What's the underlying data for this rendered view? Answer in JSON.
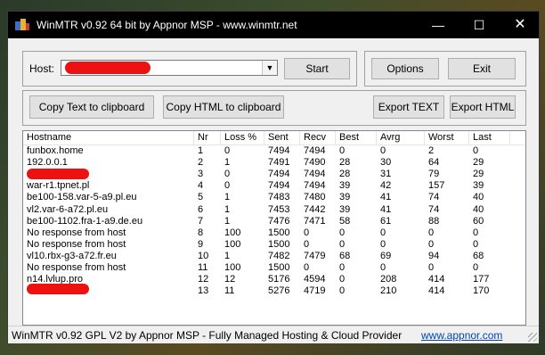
{
  "window": {
    "title": "WinMTR v0.92 64 bit by Appnor MSP - www.winmtr.net",
    "minimize_glyph": "—",
    "maximize_glyph": "☐",
    "close_glyph": "✕"
  },
  "host": {
    "label": "Host:",
    "value": ""
  },
  "buttons": {
    "start": "Start",
    "options": "Options",
    "exit": "Exit",
    "copy_text": "Copy Text to clipboard",
    "copy_html": "Copy HTML to clipboard",
    "export_text": "Export TEXT",
    "export_html": "Export HTML"
  },
  "table": {
    "columns": [
      "Hostname",
      "Nr",
      "Loss %",
      "Sent",
      "Recv",
      "Best",
      "Avrg",
      "Worst",
      "Last"
    ],
    "rows": [
      [
        "funbox.home",
        "1",
        "0",
        "7494",
        "7494",
        "0",
        "0",
        "2",
        "0"
      ],
      [
        "192.0.0.1",
        "2",
        "1",
        "7491",
        "7490",
        "28",
        "30",
        "64",
        "29"
      ],
      [
        "",
        "3",
        "0",
        "7494",
        "7494",
        "28",
        "31",
        "79",
        "29"
      ],
      [
        "war-r1.tpnet.pl",
        "4",
        "0",
        "7494",
        "7494",
        "39",
        "42",
        "157",
        "39"
      ],
      [
        "be100-158.var-5-a9.pl.eu",
        "5",
        "1",
        "7483",
        "7480",
        "39",
        "41",
        "74",
        "40"
      ],
      [
        "vl2.var-6-a72.pl.eu",
        "6",
        "1",
        "7453",
        "7442",
        "39",
        "41",
        "74",
        "40"
      ],
      [
        "be100-1102.fra-1-a9.de.eu",
        "7",
        "1",
        "7476",
        "7471",
        "58",
        "61",
        "88",
        "60"
      ],
      [
        "No response from host",
        "8",
        "100",
        "1500",
        "0",
        "0",
        "0",
        "0",
        "0"
      ],
      [
        "No response from host",
        "9",
        "100",
        "1500",
        "0",
        "0",
        "0",
        "0",
        "0"
      ],
      [
        "vl10.rbx-g3-a72.fr.eu",
        "10",
        "1",
        "7482",
        "7479",
        "68",
        "69",
        "94",
        "68"
      ],
      [
        "No response from host",
        "11",
        "100",
        "1500",
        "0",
        "0",
        "0",
        "0",
        "0"
      ],
      [
        "n14.lvlup.pro",
        "12",
        "12",
        "5176",
        "4594",
        "0",
        "208",
        "414",
        "177"
      ],
      [
        "",
        "13",
        "11",
        "5276",
        "4719",
        "0",
        "210",
        "414",
        "170"
      ]
    ]
  },
  "status": {
    "text": "WinMTR v0.92 GPL V2 by Appnor MSP - Fully Managed Hosting & Cloud Provider",
    "link": "www.appnor.com"
  },
  "colors": {
    "titlebar": "#000000",
    "redaction": "#ee1111",
    "link": "#0645ad"
  }
}
